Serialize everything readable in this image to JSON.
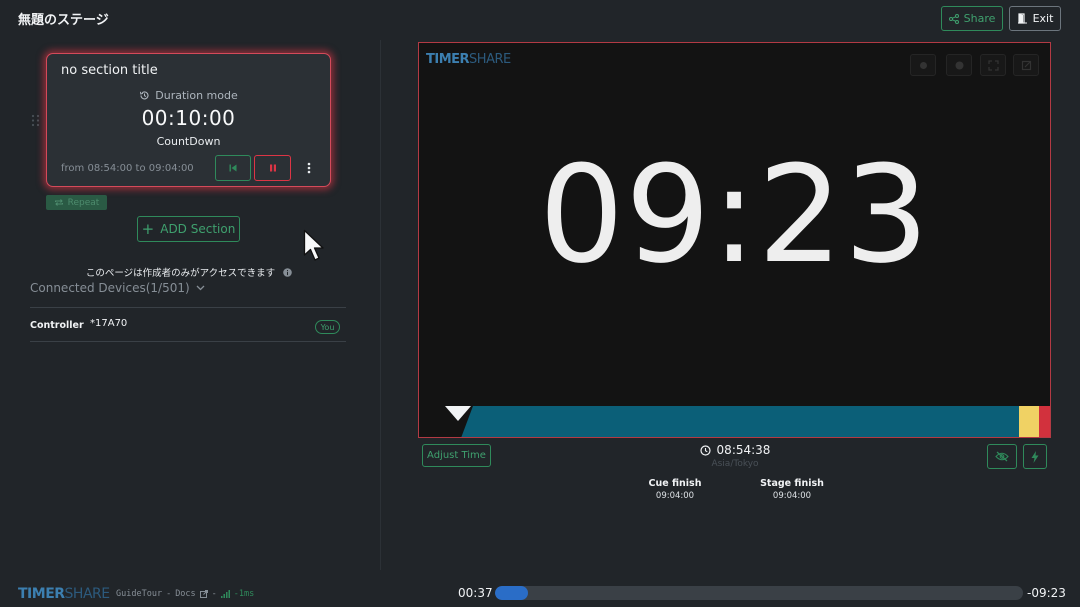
{
  "header": {
    "stage_title": "無題のステージ",
    "share_label": "Share",
    "exit_label": "Exit"
  },
  "cue": {
    "title": "no section title",
    "mode_label": "Duration mode",
    "duration": "00:10:00",
    "type": "CountDown",
    "range": "from 08:54:00 to 09:04:00",
    "repeat_label": "Repeat"
  },
  "sidebar": {
    "add_section_label": "ADD Section",
    "access_note": "このページは作成者のみがアクセスできます",
    "devices_label": "Connected Devices(1/501)",
    "device": {
      "role": "Controller",
      "id": "*17A70",
      "badge": "You"
    }
  },
  "display": {
    "logo_timer": "TIMER",
    "logo_share": "SHARE",
    "big_time": "09:23",
    "progress": {
      "elapsed_fraction": 0.06,
      "warning_color": "#f0d264",
      "danger_color": "#d2313d",
      "main_color": "#0b5f78"
    }
  },
  "controls": {
    "adjust_label": "Adjust Time",
    "clock": "08:54:38",
    "timezone": "Asia/Tokyo",
    "cue_finish_label": "Cue finish",
    "cue_finish_value": "09:04:00",
    "stage_finish_label": "Stage finish",
    "stage_finish_value": "09:04:00"
  },
  "footer": {
    "logo_timer": "TIMER",
    "logo_share": "SHARE",
    "guide_label": "GuideTour",
    "sep1": "-",
    "docs_label": "Docs",
    "sep2": "-",
    "latency": "-1ms",
    "elapsed": "00:37",
    "remaining": "-09:23",
    "seek_fraction": 0.062
  },
  "colors": {
    "accent_green": "#2f8a5b",
    "danger": "#dc3545",
    "background": "#212529"
  }
}
